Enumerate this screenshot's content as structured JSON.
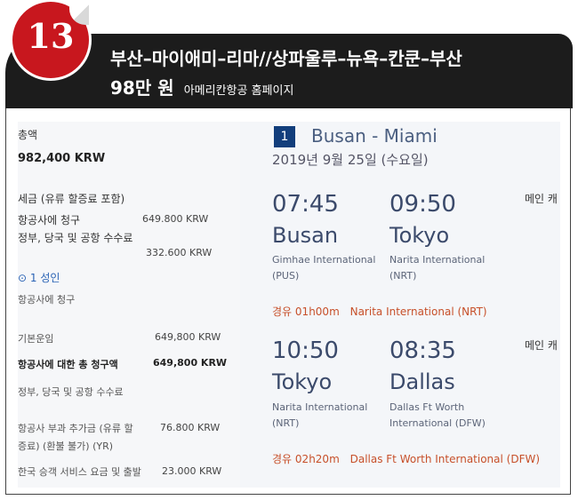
{
  "header": {
    "badge_number": "13",
    "route": "부산–마이애미–리마//상파울루–뉴욕–칸쿤–부산",
    "price": "98만 원",
    "source": "아메리칸항공 홈페이지"
  },
  "summary": {
    "total_label": "총액",
    "total_amount": "982,400 KRW",
    "tax_label": "세금 (유류 할증료 포함)",
    "airline_charge_label": "항공사에 청구",
    "airline_charge_amount": "649.800 KRW",
    "gov_fees_label": "정부, 당국 및 공항 수수료",
    "gov_fees_amount": "332.600 KRW",
    "passenger_label": "1 성인",
    "passenger_sub": "항공사에 청구",
    "base_fare_label": "기본운임",
    "base_fare_amount": "649,800 KRW",
    "total_airline_label": "항공사에 대한 총 청구액",
    "total_airline_amount": "649,800 KRW",
    "gov_fees_label2": "정부, 당국 및 공항 수수료",
    "surcharge_label_1": "항공사 부과 추가금 (유류 할",
    "surcharge_amount": "76.800 KRW",
    "surcharge_label_2": "증료) (환불 불가) (YR)",
    "korea_fee_label": "한국 승객 서비스 요금 및 출발",
    "korea_fee_amount": "23.000 KRW"
  },
  "itinerary": {
    "segment_number": "1",
    "segment_route": "Busan - Miami",
    "date": "2019년 9월 25일 (수요일)",
    "flights": [
      {
        "dep_time": "07:45",
        "arr_time": "09:50",
        "dep_city": "Busan",
        "arr_city": "Tokyo",
        "dep_airport": "Gimhae International",
        "dep_code": "(PUS)",
        "arr_airport": "Narita International",
        "arr_code": "(NRT)",
        "cabin": "메인 캐",
        "stop_label": "경유",
        "stop_duration": "01h00m",
        "stop_airport": "Narita International (NRT)"
      },
      {
        "dep_time": "10:50",
        "arr_time": "08:35",
        "dep_city": "Tokyo",
        "arr_city": "Dallas",
        "dep_airport": "Narita International",
        "dep_code": "(NRT)",
        "arr_airport": "Dallas Ft Worth",
        "arr_code": "International (DFW)",
        "cabin": "메인 캐",
        "stop_label": "경유",
        "stop_duration": "02h20m",
        "stop_airport": "Dallas Ft Worth International (DFW)"
      }
    ]
  },
  "colors": {
    "badge": "#c8171e",
    "header_bg": "#1c1c1c",
    "segment_badge": "#123e7c",
    "stop_text": "#c7502a",
    "link_blue": "#2a63b5"
  }
}
